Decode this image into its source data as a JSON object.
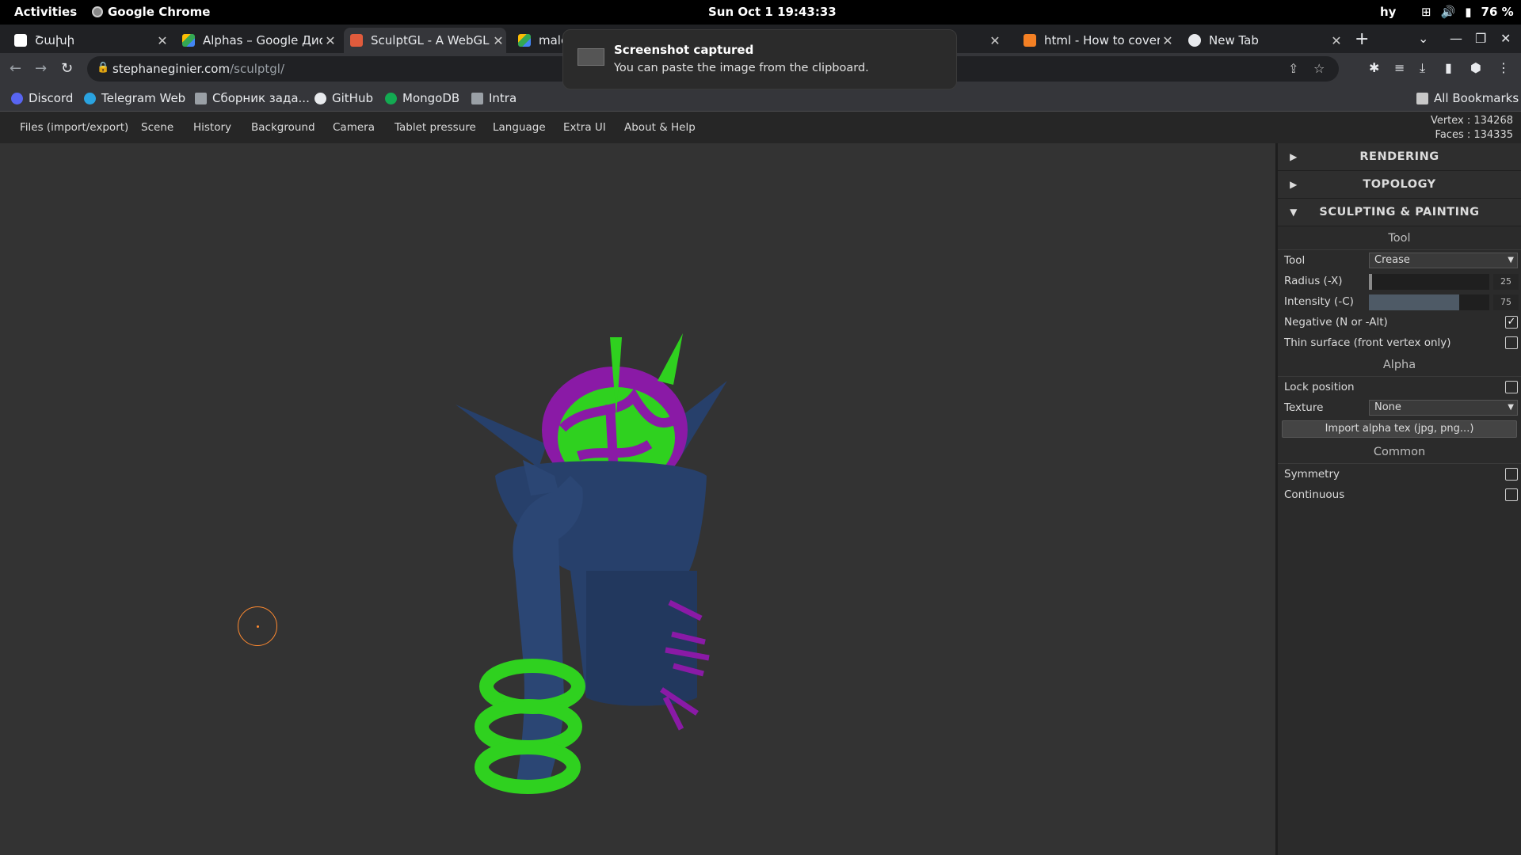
{
  "system_bar": {
    "activities": "Activities",
    "app_name": "Google Chrome",
    "clock": "Sun Oct 1  19:43:33",
    "language": "hy",
    "battery": "76 %"
  },
  "tabs": [
    {
      "title": "Շախի",
      "icon": "tab-favicon"
    },
    {
      "title": "Alphas – Google Диск",
      "icon": "drive-icon"
    },
    {
      "title": "SculptGL - A WebGL s",
      "icon": "sculptgl-icon"
    },
    {
      "title": "male",
      "icon": "drive-icon"
    },
    {
      "title": "html - How to cover a",
      "icon": "stackoverflow-icon"
    },
    {
      "title": "New Tab",
      "icon": "chrome-icon"
    }
  ],
  "address": {
    "host": "stephaneginier.com",
    "path": "/sculptgl/"
  },
  "bookmarks": [
    {
      "label": "Discord",
      "color": "#5865f2"
    },
    {
      "label": "Telegram Web",
      "color": "#2aa3e0"
    },
    {
      "label": "Сборник зада...",
      "color": "#9aa0a6"
    },
    {
      "label": "GitHub",
      "color": "#e8eaed"
    },
    {
      "label": "MongoDB",
      "color": "#13aa52"
    },
    {
      "label": "Intra",
      "color": "#9aa0a6"
    }
  ],
  "all_bookmarks": "All Bookmarks",
  "notification": {
    "title": "Screenshot captured",
    "body": "You can paste the image from the clipboard."
  },
  "sculpt_menu": [
    "Files (import/export)",
    "Scene",
    "History",
    "Background",
    "Camera",
    "Tablet pressure",
    "Language",
    "Extra UI",
    "About & Help"
  ],
  "stats": {
    "vertex": "Vertex : 134268",
    "faces": "Faces : 134335"
  },
  "gui": {
    "rendering": "RENDERING",
    "topology": "TOPOLOGY",
    "sculpting": "SCULPTING & PAINTING",
    "tool_section": "Tool",
    "tool_label": "Tool",
    "tool_value": "Crease",
    "radius_label": "Radius (-X)",
    "radius_value": "25",
    "radius_fraction": 0.02,
    "intensity_label": "Intensity (-C)",
    "intensity_value": "75",
    "intensity_fraction": 0.75,
    "negative_label": "Negative (N or -Alt)",
    "negative_checked": true,
    "thin_label": "Thin surface (front vertex only)",
    "thin_checked": false,
    "alpha_section": "Alpha",
    "lock_label": "Lock position",
    "texture_label": "Texture",
    "texture_value": "None",
    "import_btn": "Import alpha tex (jpg, png...)",
    "common_section": "Common",
    "symmetry_label": "Symmetry",
    "continuous_label": "Continuous"
  },
  "colors": {
    "mesh_blue": "#27406b",
    "mesh_green": "#2fd11f",
    "mesh_purple": "#8a1aa6",
    "cursor": "#ff8a30"
  }
}
